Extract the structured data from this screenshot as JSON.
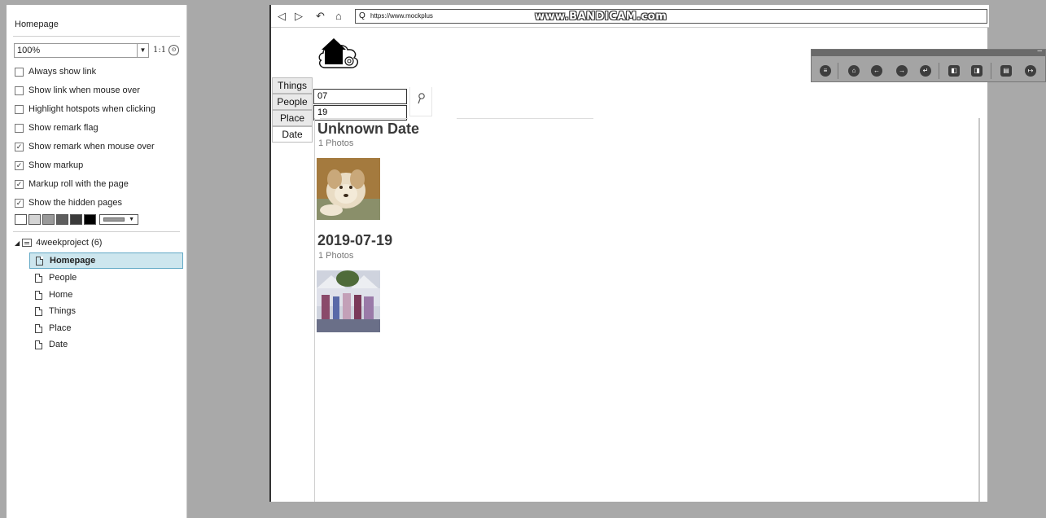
{
  "left_panel": {
    "title": "Homepage",
    "zoom_value": "100%",
    "zoom_arrow": "▼",
    "ratio_label": "1:1",
    "ratio_button": "⊙",
    "options": [
      {
        "label": "Always show link",
        "checked": false
      },
      {
        "label": "Show link when mouse over",
        "checked": false
      },
      {
        "label": "Highlight hotspots when clicking",
        "checked": false
      },
      {
        "label": "Show remark flag",
        "checked": false
      },
      {
        "label": "Show remark when mouse over",
        "checked": true
      },
      {
        "label": "Show markup",
        "checked": true
      },
      {
        "label": "Markup roll with the page",
        "checked": true
      },
      {
        "label": "Show the hidden pages",
        "checked": true
      }
    ],
    "swatch_colors": [
      "#ffffff",
      "#d4d4d4",
      "#9a9a9a",
      "#5e5e5e",
      "#3a3a3a",
      "#000000"
    ],
    "swatch_dropdown_arrow": "▼",
    "tree": {
      "project_label": "4weekproject (6)",
      "caret": "◢",
      "pages": [
        "Homepage",
        "People",
        "Home",
        "Things",
        "Place",
        "Date"
      ],
      "selected": "Homepage"
    }
  },
  "browser": {
    "nav_icons": [
      "◁",
      "▷",
      "↶",
      "⌂"
    ],
    "search_glyph": "Q",
    "url": "https://www.mockplus",
    "watermark": "www.BANDICAM.com"
  },
  "app": {
    "tabs": [
      "Things",
      "People",
      "Place",
      "Date"
    ],
    "active_tab": "Date",
    "date_inputs": [
      "07",
      "19"
    ],
    "search_icon": "search-icon",
    "sections": [
      {
        "title": "Unknown Date",
        "count": "1 Photos",
        "photo": "dog-photo"
      },
      {
        "title": "2019-07-19",
        "count": "1 Photos",
        "photo": "event-photo"
      }
    ]
  },
  "float_toolbar": {
    "close_glyph": "–",
    "buttons": [
      "menu-icon",
      "home-icon",
      "back-icon",
      "forward-icon",
      "return-icon",
      "page-prev-icon",
      "page-next-icon",
      "notes-icon",
      "exit-icon"
    ],
    "glyphs": [
      "≡",
      "⌂",
      "←",
      "→",
      "↵",
      "◧",
      "◨",
      "▤",
      "↦"
    ]
  }
}
